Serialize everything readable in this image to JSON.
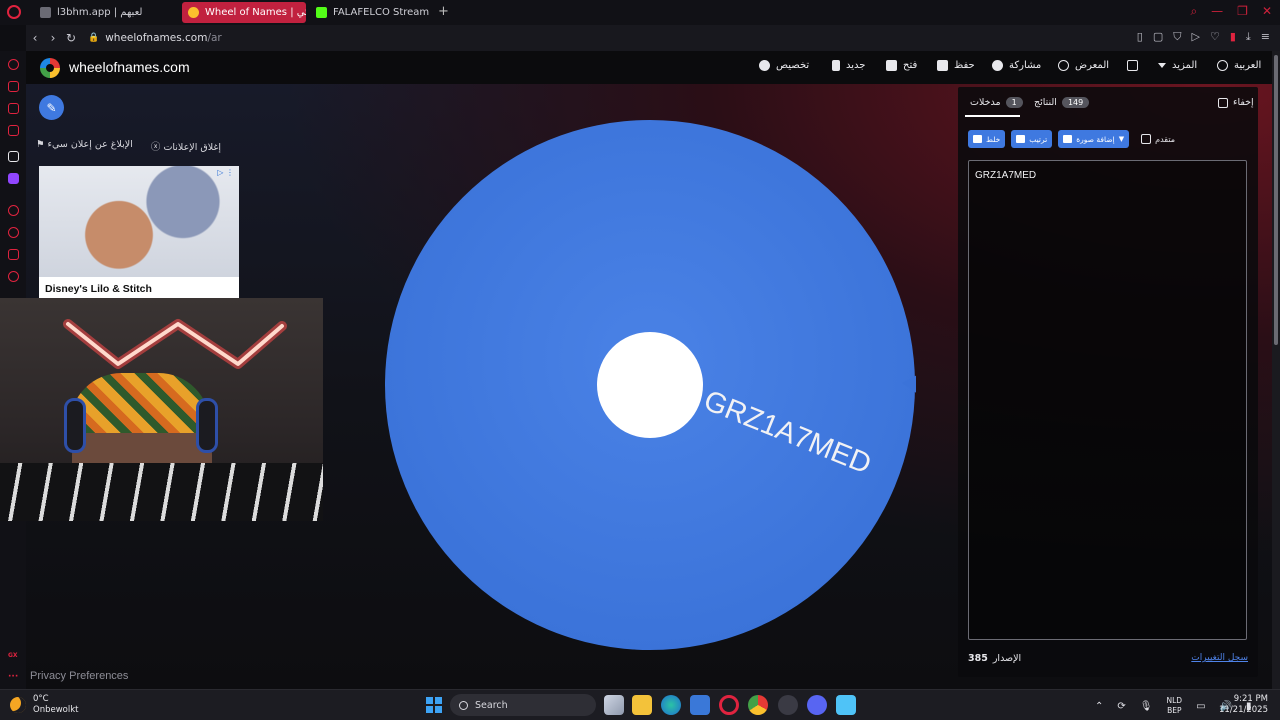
{
  "browser": {
    "tabs": [
      {
        "label": "l3bhm.app | لعبهم",
        "active": false
      },
      {
        "label": "Wheel of Names | عشوائي",
        "active": true
      },
      {
        "label": "FALAFELCO Stream - Wat",
        "active": false
      }
    ],
    "url_host": "wheelofnames.com",
    "url_path": "/ar"
  },
  "sidebar": {
    "gx_label": "GX"
  },
  "site": {
    "name": "wheelofnames.com",
    "menu": {
      "customize": "تخصيص",
      "new": "جديد",
      "open": "فتح",
      "save": "حفظ",
      "share": "مشاركة",
      "gallery": "المعرض",
      "more": "المزيد",
      "language": "العربية"
    }
  },
  "ads": {
    "close_ads": "إغلاق الإعلانات",
    "report_ad": "الإبلاغ عن إعلان سيء",
    "title": "Disney's Lilo & Stitch"
  },
  "wheel": {
    "segment_label": "GRZ1A7MED",
    "segment_color": "#3f79e0"
  },
  "panel": {
    "tab_entries": "مدخلات",
    "entries_count": "1",
    "tab_results": "النتائج",
    "results_count": "149",
    "hide_label": "إخفاء",
    "shuffle": "خلط",
    "sort": "ترتيب",
    "add_image": "إضافة صورة",
    "advanced": "متقدم",
    "entries": [
      "GRZ1A7MED"
    ],
    "version_label": "الإصدار",
    "version": "385",
    "changelog": "سجل التغييرات"
  },
  "privacy": "Privacy Preferences",
  "taskbar": {
    "temperature": "0°C",
    "weather": "Onbewolkt",
    "search_placeholder": "Search",
    "lang1": "NLD",
    "lang2": "BEP",
    "time": "9:21 PM",
    "date": "11/21/2025"
  }
}
